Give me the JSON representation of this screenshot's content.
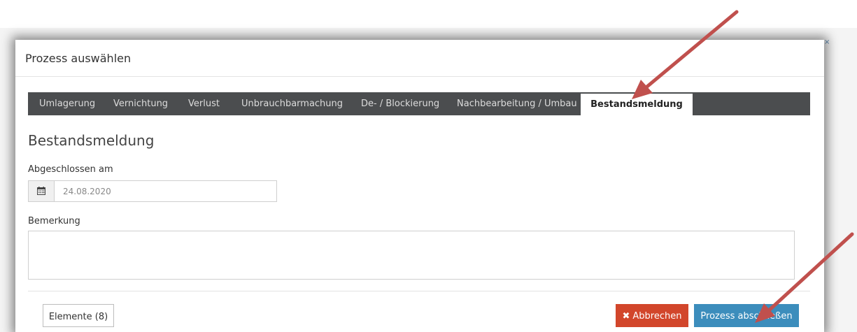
{
  "dialog": {
    "title": "Prozess auswählen",
    "close_icon": "close-icon"
  },
  "tabs": [
    {
      "label": "Umlagerung",
      "active": false
    },
    {
      "label": "Vernichtung",
      "active": false
    },
    {
      "label": "Verlust",
      "active": false
    },
    {
      "label": "Unbrauchbarmachung",
      "active": false
    },
    {
      "label": "De- / Blockierung",
      "active": false
    },
    {
      "label": "Nachbearbeitung / Umbau",
      "active": false
    },
    {
      "label": "Bestandsmeldung",
      "active": true
    }
  ],
  "form": {
    "section_title": "Bestandsmeldung",
    "date_label": "Abgeschlossen am",
    "date_value": "24.08.2020",
    "date_icon": "calendar-icon",
    "remark_label": "Bemerkung",
    "remark_value": ""
  },
  "footer": {
    "elements_button": "Elemente (8)",
    "cancel_button": "Abbrechen",
    "cancel_icon": "times-icon",
    "submit_button": "Prozess abschließen"
  },
  "colors": {
    "tabbar_bg": "#4b4d4f",
    "cancel_bg": "#d2462b",
    "submit_bg": "#3c8dbc",
    "annotation_arrow": "#c0504d"
  }
}
